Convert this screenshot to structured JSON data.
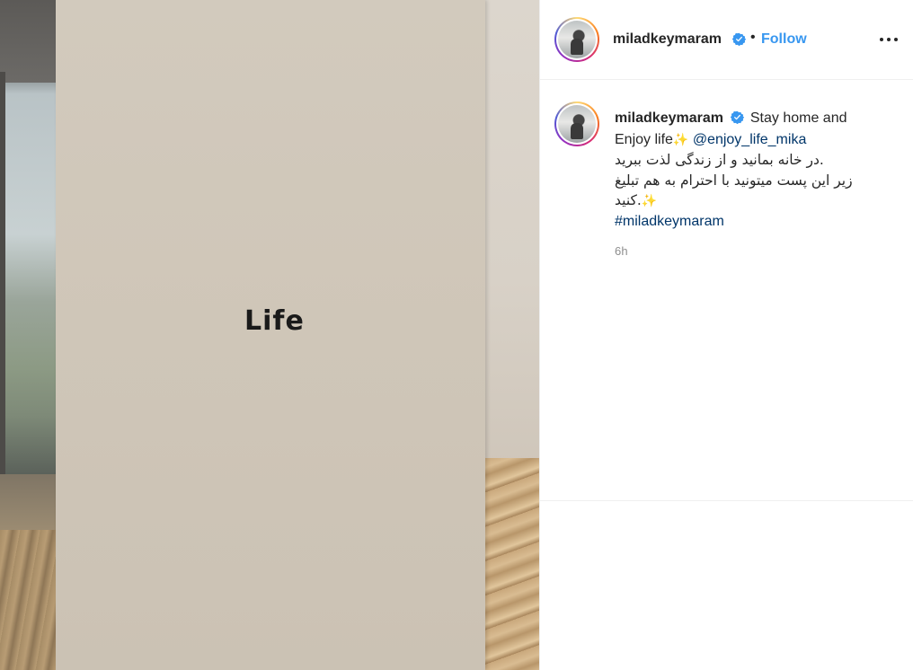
{
  "post": {
    "image_text": "Life",
    "username": "miladkeymaram",
    "follow_label": "Follow",
    "separator": "•",
    "caption": {
      "text_en": "Stay home and Enjoy life",
      "mention": "@enjoy_life_mika",
      "fa_line1": ".در خانه بمانید و از زندگی لذت ببرید",
      "fa_line2": "زیر این پست میتونید با احترام به هم تبلیغ",
      "fa_line3": ".کنید",
      "hashtag": "#miladkeymaram"
    },
    "time": "6h"
  },
  "icons": {
    "verified": "verified-badge-icon",
    "more": "more-options-icon",
    "sparkle": "sparkles-icon"
  },
  "colors": {
    "accent": "#3897f0",
    "link": "#003569",
    "muted": "#8e8e8e"
  }
}
